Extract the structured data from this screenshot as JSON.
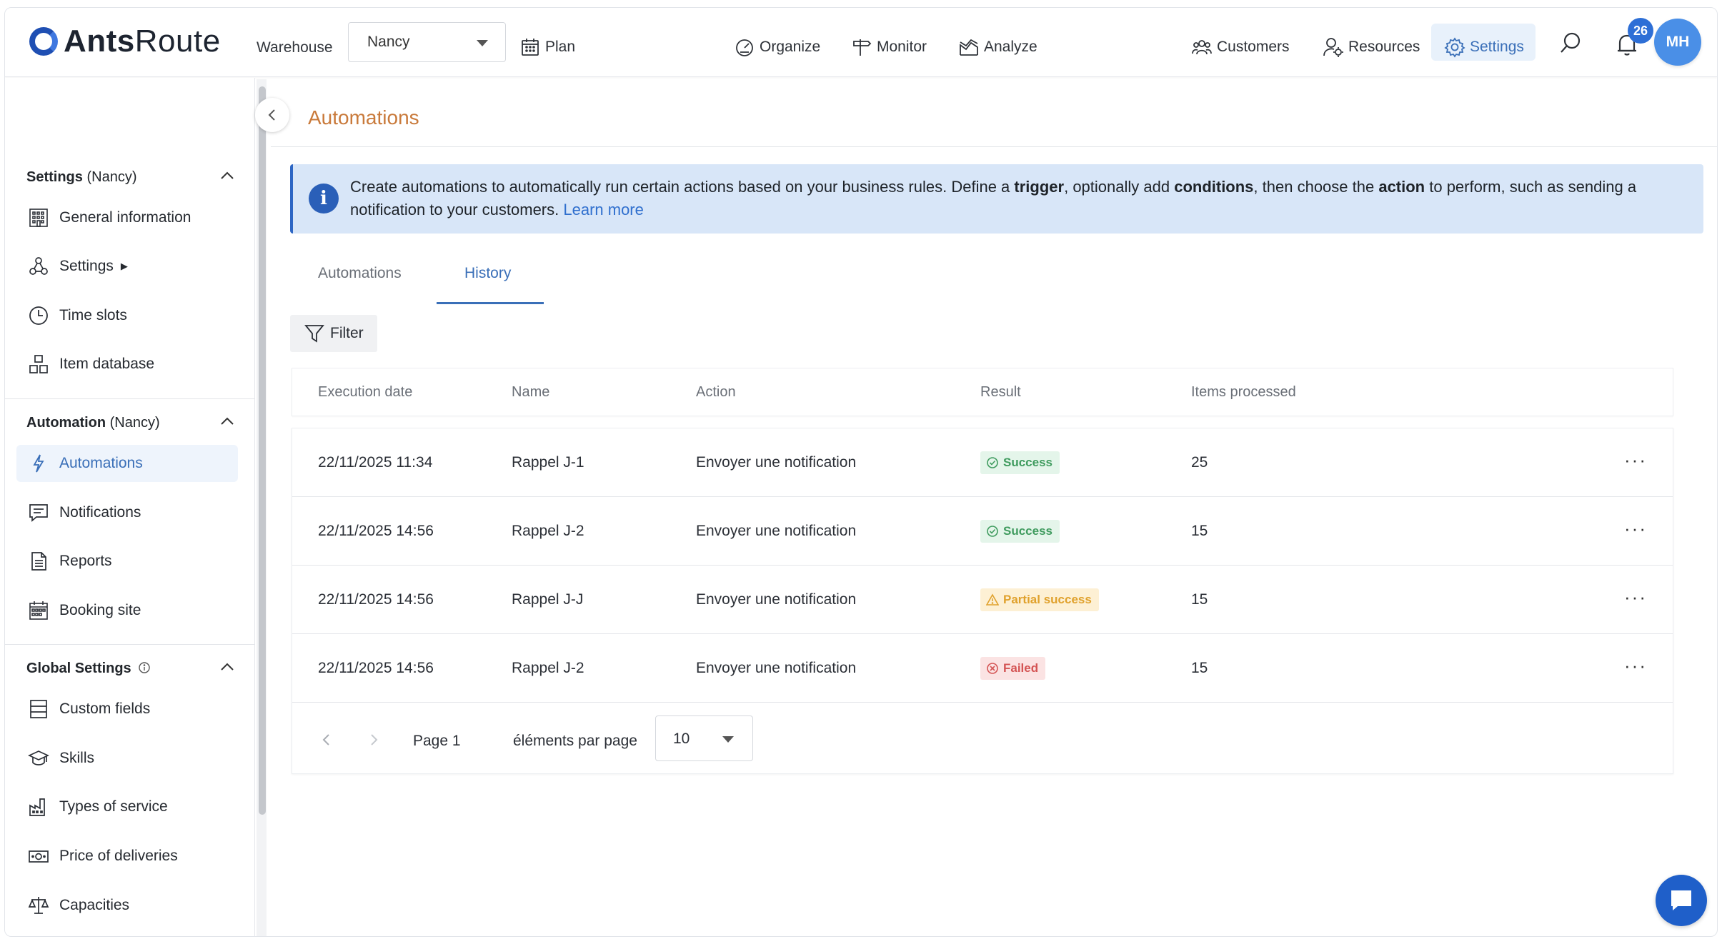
{
  "app": {
    "brand_bold": "Ants",
    "brand_regular": "Route"
  },
  "header": {
    "warehouse_label": "Warehouse",
    "warehouse_value": "Nancy",
    "nav": [
      {
        "label": "Plan",
        "icon": "calendar-icon"
      },
      {
        "label": "Organize",
        "icon": "gauge-icon"
      },
      {
        "label": "Monitor",
        "icon": "signpost-icon"
      },
      {
        "label": "Analyze",
        "icon": "chart-icon"
      }
    ],
    "right_nav": [
      {
        "label": "Customers",
        "icon": "customers-icon"
      },
      {
        "label": "Resources",
        "icon": "resources-icon"
      },
      {
        "label": "Settings",
        "icon": "gear-icon",
        "active": true
      }
    ],
    "notification_count": "26",
    "avatar_initials": "MH"
  },
  "sidebar": {
    "sections": [
      {
        "title_bold": "Settings",
        "title_suffix": " (Nancy)",
        "items": [
          {
            "label": "General information",
            "icon": "building-icon"
          },
          {
            "label": "Settings",
            "icon": "nodes-icon",
            "submenu_marker": "▶"
          },
          {
            "label": "Time slots",
            "icon": "clock-icon"
          },
          {
            "label": "Item database",
            "icon": "boxes-icon"
          }
        ]
      },
      {
        "title_bold": "Automation",
        "title_suffix": " (Nancy)",
        "items": [
          {
            "label": "Automations",
            "icon": "lightning-icon",
            "active": true
          },
          {
            "label": "Notifications",
            "icon": "message-icon"
          },
          {
            "label": "Reports",
            "icon": "document-icon"
          },
          {
            "label": "Booking site",
            "icon": "calendar-grid-icon"
          }
        ]
      },
      {
        "title_bold": "Global Settings",
        "title_suffix": "",
        "items": [
          {
            "label": "Custom fields",
            "icon": "fields-icon"
          },
          {
            "label": "Skills",
            "icon": "graduation-cap-icon"
          },
          {
            "label": "Types of service",
            "icon": "factory-icon"
          },
          {
            "label": "Price of deliveries",
            "icon": "money-icon"
          },
          {
            "label": "Capacities",
            "icon": "balance-icon"
          }
        ]
      }
    ]
  },
  "main": {
    "title": "Automations",
    "info": {
      "part1": "Create automations to automatically run certain actions based on your business rules. Define a ",
      "trigger": "trigger",
      "part2": ", optionally add ",
      "conditions": "conditions",
      "part3": ", then choose the ",
      "action": "action",
      "part4": " to perform, such as sending a notification to your customers. ",
      "learn_more": "Learn more"
    },
    "tabs": [
      {
        "label": "Automations",
        "active": false
      },
      {
        "label": "History",
        "active": true
      }
    ],
    "filter_label": "Filter",
    "table": {
      "columns": [
        "Execution date",
        "Name",
        "Action",
        "Result",
        "Items processed"
      ],
      "rows": [
        {
          "date": "22/11/2025 11:34",
          "name": "Rappel J-1",
          "action": "Envoyer une notification",
          "result": "Success",
          "result_type": "success",
          "items": "25"
        },
        {
          "date": "22/11/2025 14:56",
          "name": "Rappel J-2",
          "action": "Envoyer une notification",
          "result": "Success",
          "result_type": "success",
          "items": "15"
        },
        {
          "date": "22/11/2025 14:56",
          "name": "Rappel J-J",
          "action": "Envoyer une notification",
          "result": "Partial success",
          "result_type": "partial",
          "items": "15"
        },
        {
          "date": "22/11/2025 14:56",
          "name": "Rappel J-2",
          "action": "Envoyer une notification",
          "result": "Failed",
          "result_type": "failed",
          "items": "15"
        }
      ],
      "row_menu": "···"
    },
    "pagination": {
      "page_label": "Page 1",
      "per_page_label": "éléments par page",
      "per_page_value": "10"
    }
  },
  "colors": {
    "accent": "#3a6fb8",
    "title": "#c97a3b",
    "banner_bg": "#d8e6f8",
    "success": "#3f9b5e",
    "partial": "#e0a12c",
    "failed": "#d45454"
  }
}
